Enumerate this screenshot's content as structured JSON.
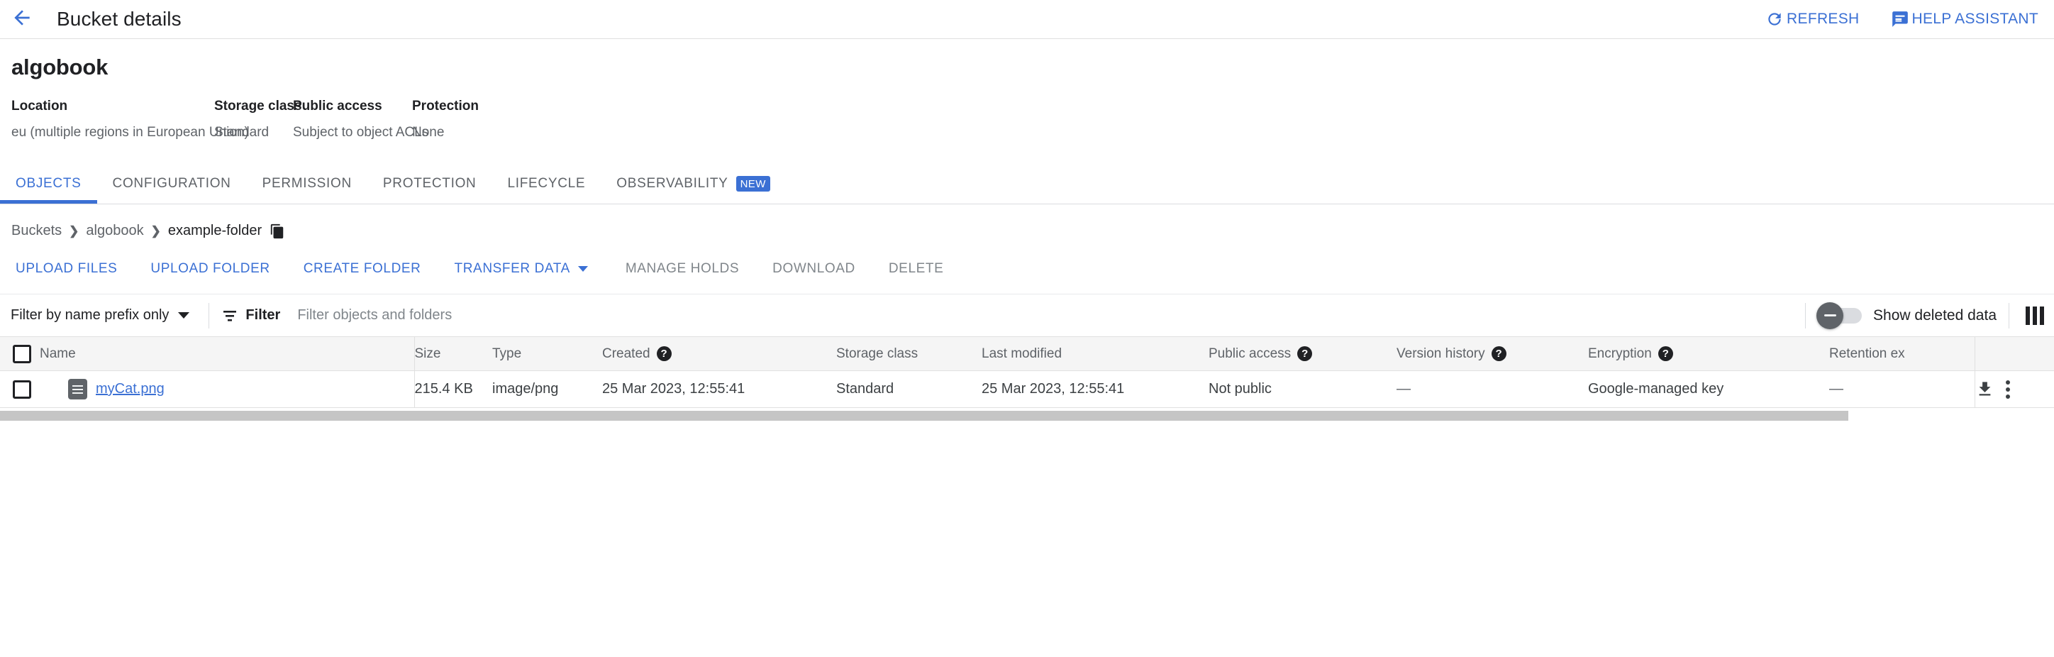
{
  "appbar": {
    "back_icon": "arrow-left-icon",
    "title": "Bucket details",
    "refresh_label": "REFRESH",
    "refresh_icon": "refresh-icon",
    "help_label": "HELP ASSISTANT",
    "help_icon": "chat-help-icon"
  },
  "summary": {
    "bucket_name": "algobook",
    "fields": [
      {
        "label": "Location",
        "value": "eu (multiple regions in European Union)"
      },
      {
        "label": "Storage class",
        "value": "Standard"
      },
      {
        "label": "Public access",
        "value": "Subject to object ACLs"
      },
      {
        "label": "Protection",
        "value": "None"
      }
    ]
  },
  "tabs": [
    {
      "label": "OBJECTS",
      "active": true,
      "badge": ""
    },
    {
      "label": "CONFIGURATION",
      "active": false,
      "badge": ""
    },
    {
      "label": "PERMISSION",
      "active": false,
      "badge": ""
    },
    {
      "label": "PROTECTION",
      "active": false,
      "badge": ""
    },
    {
      "label": "LIFECYCLE",
      "active": false,
      "badge": ""
    },
    {
      "label": "OBSERVABILITY",
      "active": false,
      "badge": "NEW"
    }
  ],
  "breadcrumb": {
    "items": [
      "Buckets",
      "algobook",
      "example-folder"
    ],
    "separator": "❯",
    "copy_icon": "copy-icon"
  },
  "toolbar": {
    "upload_files": "UPLOAD FILES",
    "upload_folder": "UPLOAD FOLDER",
    "create_folder": "CREATE FOLDER",
    "transfer_data": "TRANSFER DATA",
    "manage_holds": "MANAGE HOLDS",
    "download": "DOWNLOAD",
    "delete": "DELETE"
  },
  "filterbar": {
    "prefix_select": "Filter by name prefix only",
    "filter_icon": "filter-icon",
    "filter_label": "Filter",
    "filter_placeholder": "Filter objects and folders",
    "filter_value": "",
    "show_deleted_label": "Show deleted data",
    "show_deleted_on": false,
    "columns_icon": "column-settings-icon"
  },
  "table": {
    "columns": [
      {
        "label": "",
        "help": false
      },
      {
        "label": "Name",
        "help": false
      },
      {
        "label": "Size",
        "help": false
      },
      {
        "label": "Type",
        "help": false
      },
      {
        "label": "Created",
        "help": true
      },
      {
        "label": "Storage class",
        "help": false
      },
      {
        "label": "Last modified",
        "help": false
      },
      {
        "label": "Public access",
        "help": true
      },
      {
        "label": "Version history",
        "help": true
      },
      {
        "label": "Encryption",
        "help": true
      },
      {
        "label": "Retention ex",
        "help": false
      },
      {
        "label": "",
        "help": false
      }
    ],
    "rows": [
      {
        "name": "myCat.png",
        "size": "215.4 KB",
        "type": "image/png",
        "created": "25 Mar 2023, 12:55:41",
        "storage_class": "Standard",
        "last_modified": "25 Mar 2023, 12:55:41",
        "public_access": "Not public",
        "version_history": "—",
        "encryption": "Google-managed key",
        "retention": "—",
        "download_icon": "download-icon",
        "more_icon": "more-vert-icon",
        "file_icon": "file-icon"
      }
    ]
  },
  "colors": {
    "accent": "#3b70d4",
    "text_primary": "#202124",
    "text_secondary": "#5f6368",
    "header_bg": "#f5f5f5",
    "border": "#e0e0e0"
  }
}
